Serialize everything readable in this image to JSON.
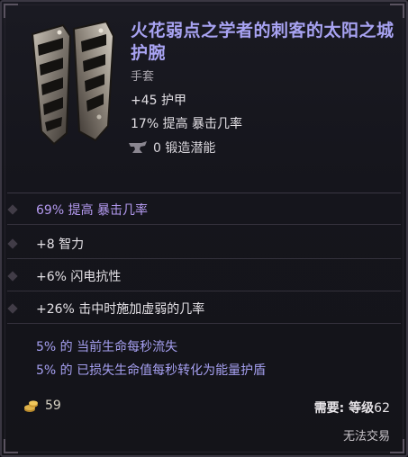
{
  "item": {
    "title": "火花弱点之学者的刺客的太阳之城护腕",
    "type": "手套",
    "base_stats": [
      "+45 护甲",
      "17% 提高 暴击几率"
    ],
    "forge_potential": "0 锻造潜能"
  },
  "modifiers": [
    "69% 提高 暴击几率",
    "+8 智力",
    "+6% 闪电抗性",
    "+26% 击中时施加虚弱的几率"
  ],
  "affix_effects": [
    "5% 的 当前生命每秒流失",
    "5% 的 已损失生命值每秒转化为能量护盾"
  ],
  "footer": {
    "gold": "59",
    "requirement_label": "需要: 等级",
    "requirement_level": "62",
    "untradeable": "无法交易"
  },
  "colors": {
    "title": "#a8a3f2",
    "modifier_highlight": "#b49af0",
    "text": "#e4e1e6"
  },
  "icons": {
    "item": "bracer-icon",
    "forge": "anvil-icon",
    "gold": "gold-coins-icon"
  }
}
